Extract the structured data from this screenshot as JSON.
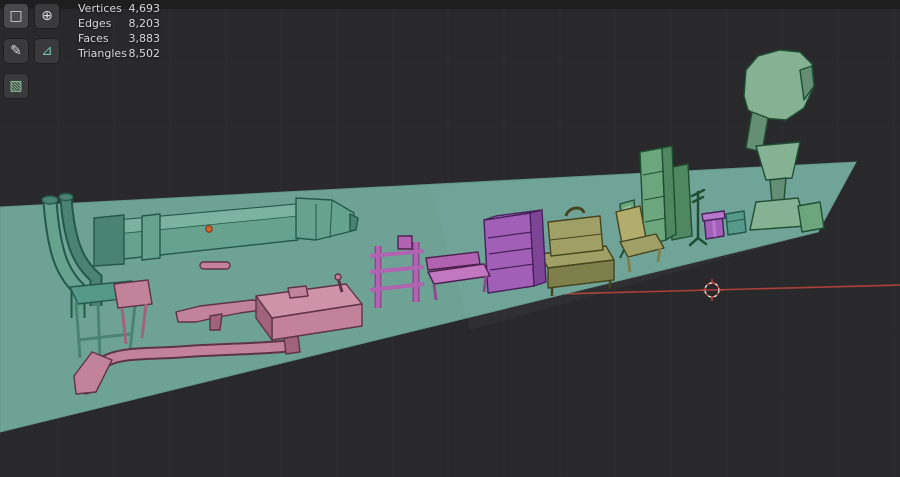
{
  "stats": {
    "rows": [
      {
        "label": "Vertices",
        "value": "4,693"
      },
      {
        "label": "Edges",
        "value": "8,203"
      },
      {
        "label": "Faces",
        "value": "3,883"
      },
      {
        "label": "Triangles",
        "value": "8,502"
      }
    ]
  },
  "toolbar": {
    "tools": [
      {
        "id": "select-box",
        "glyph": "□"
      },
      {
        "id": "cursor",
        "glyph": "⊕"
      },
      {
        "id": "annotate",
        "glyph": "✎"
      },
      {
        "id": "measure",
        "glyph": "⊿"
      },
      {
        "id": "add-cube",
        "glyph": "▧"
      }
    ]
  },
  "colors": {
    "bg": "#29292b",
    "top_strip": "#1e1e1f",
    "grid": "#323234",
    "grid_soft": "#2e2e30",
    "plane": "#6da295",
    "plane_shade": "#639789",
    "axis_x": "#b5413c",
    "cursor_red": "#cf4a42",
    "tool_btn": "#3a3a3c",
    "tool_icon": "#dcdcdc",
    "tool_icon_measure": "#72c4b4",
    "tool_icon_cube": "#93cf9f",
    "text": "#d9d9d9",
    "green_1": "#66a28e",
    "green_1_light": "#7cb3a0",
    "green_1_dark": "#4a8373",
    "green_1_line": "#24584b",
    "teal_2": "#55998b",
    "pink_1": "#c2839a",
    "pink_light": "#cf93a8",
    "pink_dark": "#a06379",
    "pink_line": "#5f3347",
    "magenta_1": "#b163b1",
    "magenta_light": "#c178c1",
    "magenta_dark": "#8d4a8f",
    "magenta_line": "#4e2150",
    "purple_1": "#a25fb8",
    "purple_light": "#b877cf",
    "purple_dark": "#7e4597",
    "purple_line": "#46215c",
    "olive_1": "#a0a066",
    "olive_dark": "#7f7f4c",
    "olive_line": "#45451f",
    "yellow_1": "#b2ad6c",
    "green_2": "#6ba67c",
    "green_2_dark": "#4f8760",
    "green_2_line": "#1f4e33",
    "green_3": "#85b293",
    "green_3_dark": "#648f75",
    "origin_orange": "#d2662e"
  }
}
